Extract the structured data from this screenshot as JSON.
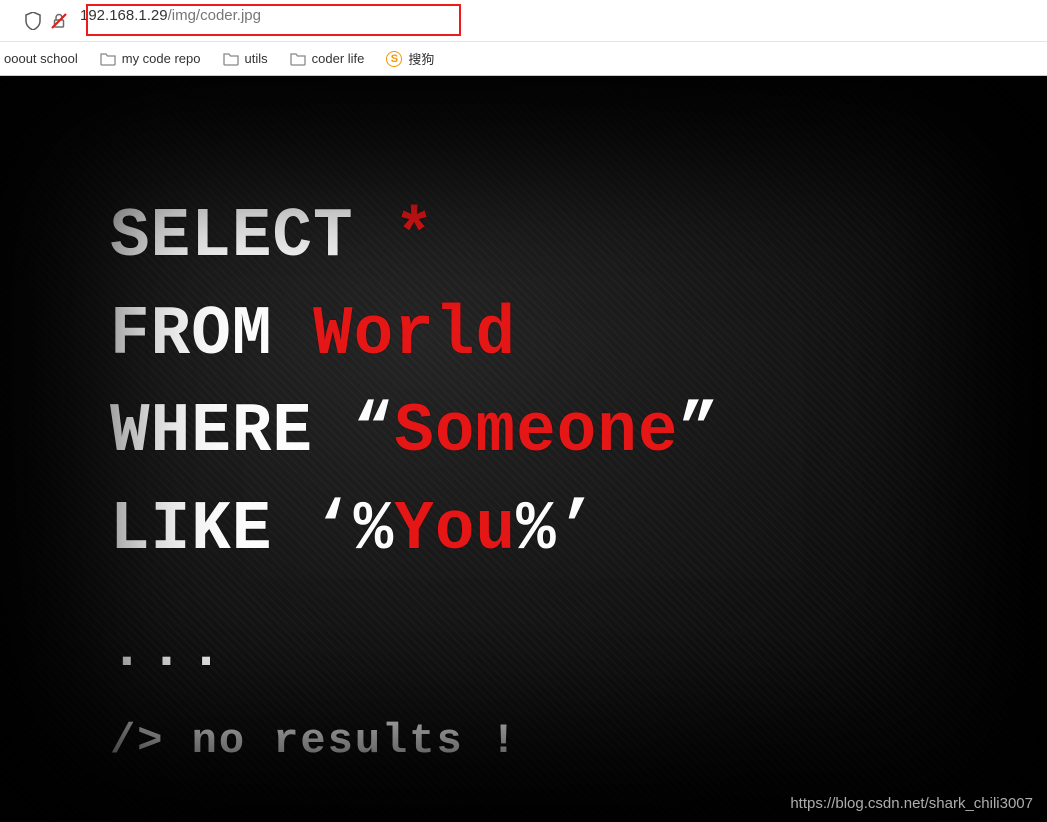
{
  "address_bar": {
    "url_dark": "192.168.1.29",
    "url_path": "/img/coder.jpg"
  },
  "bookmarks": {
    "item0": "ooout school",
    "item1": "my code repo",
    "item2": "utils",
    "item3": "coder life",
    "item4_glyph": "S",
    "item4": "搜狗"
  },
  "sql": {
    "line1_kw": "SELECT ",
    "line1_val": "*",
    "line2_kw": "FROM ",
    "line2_val": "World",
    "line3_kw": "WHERE ",
    "line3_q1": "“",
    "line3_val": "Someone",
    "line3_q2": "”",
    "line4_kw": "LIKE ",
    "line4_q1": "‘%",
    "line4_val": "You",
    "line4_q2": "%’",
    "dots": "...",
    "noresults": "/> no results !"
  },
  "watermark": "https://blog.csdn.net/shark_chili3007"
}
